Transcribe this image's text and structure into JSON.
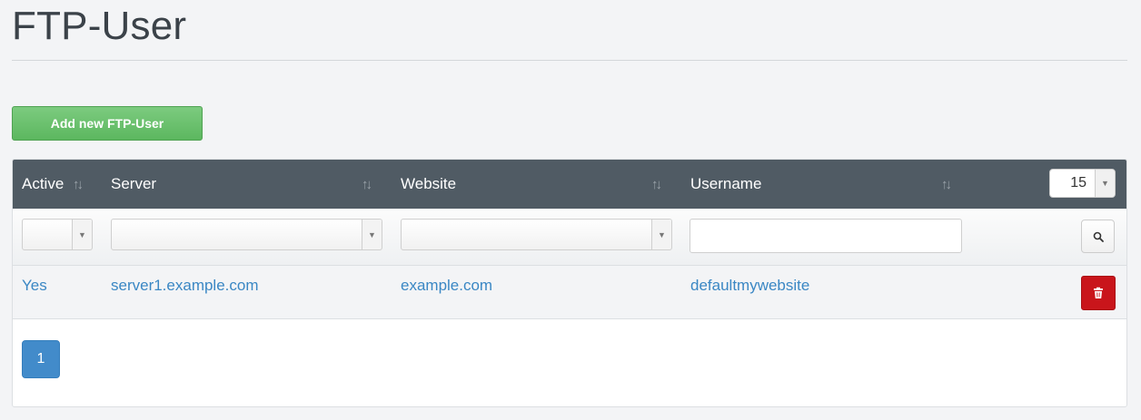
{
  "page": {
    "title": "FTP-User"
  },
  "toolbar": {
    "add_label": "Add new FTP-User"
  },
  "table": {
    "columns": [
      {
        "key": "active",
        "label": "Active"
      },
      {
        "key": "server",
        "label": "Server"
      },
      {
        "key": "website",
        "label": "Website"
      },
      {
        "key": "username",
        "label": "Username"
      }
    ],
    "page_size": "15",
    "filters": {
      "active": "",
      "server": "",
      "website": "",
      "username": ""
    },
    "rows": [
      {
        "active": "Yes",
        "server": "server1.example.com",
        "website": "example.com",
        "username": "defaultmywebsite"
      }
    ]
  },
  "pagination": {
    "current_page": "1"
  },
  "icons": {
    "sort": "sort-arrows-icon",
    "dropdown": "caret-down-icon",
    "search": "search-icon",
    "delete": "trash-icon"
  },
  "colors": {
    "header_bg": "#505b64",
    "add_button": "#5cb75f",
    "link": "#3a87c4",
    "delete_button": "#c9151b",
    "pager_active": "#428bca"
  }
}
